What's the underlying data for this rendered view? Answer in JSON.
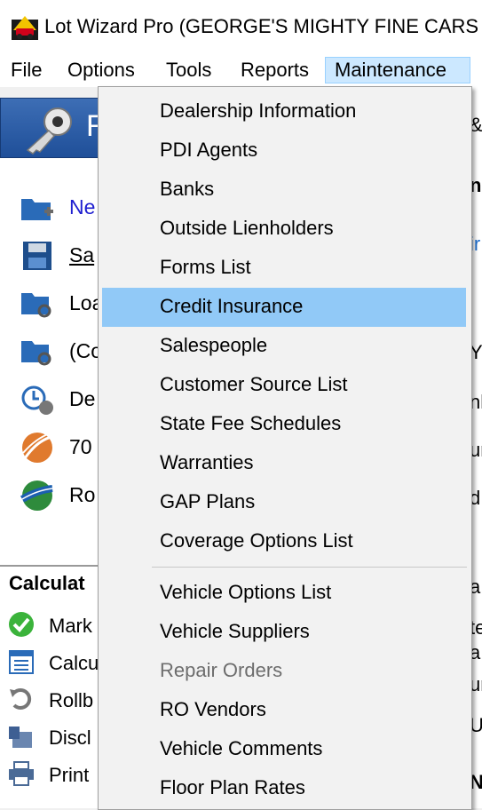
{
  "window": {
    "title": "Lot Wizard Pro (GEORGE'S  MIGHTY FINE CARS"
  },
  "menubar": {
    "items": [
      {
        "label": "File",
        "active": false
      },
      {
        "label": "Options",
        "active": false
      },
      {
        "label": "Tools",
        "active": false
      },
      {
        "label": "Reports",
        "active": false
      },
      {
        "label": "Maintenance",
        "active": true
      }
    ]
  },
  "background": {
    "panel_letter": "R",
    "left_items": [
      "Ne",
      "Sa",
      "Loa",
      "(Co",
      "De",
      "70",
      "Ro"
    ],
    "calc_header": "Calculat",
    "calc_items": [
      "Mark",
      "Calcu",
      "Rollb",
      "Discl",
      "Print"
    ],
    "right_fragments": [
      "&",
      "ni",
      "ir",
      "Y",
      "nl",
      "ur",
      "d",
      "a",
      "te",
      "a",
      "ur",
      "U",
      "N"
    ]
  },
  "maintenance_menu": {
    "group1": [
      {
        "label": "Dealership Information",
        "highlighted": false,
        "disabled": false
      },
      {
        "label": "PDI Agents",
        "highlighted": false,
        "disabled": false
      },
      {
        "label": "Banks",
        "highlighted": false,
        "disabled": false
      },
      {
        "label": "Outside Lienholders",
        "highlighted": false,
        "disabled": false
      },
      {
        "label": "Forms List",
        "highlighted": false,
        "disabled": false
      },
      {
        "label": "Credit Insurance",
        "highlighted": true,
        "disabled": false
      },
      {
        "label": "Salespeople",
        "highlighted": false,
        "disabled": false
      },
      {
        "label": "Customer Source List",
        "highlighted": false,
        "disabled": false
      },
      {
        "label": "State Fee Schedules",
        "highlighted": false,
        "disabled": false
      },
      {
        "label": "Warranties",
        "highlighted": false,
        "disabled": false
      },
      {
        "label": "GAP Plans",
        "highlighted": false,
        "disabled": false
      },
      {
        "label": "Coverage Options List",
        "highlighted": false,
        "disabled": false
      }
    ],
    "group2": [
      {
        "label": "Vehicle Options List",
        "highlighted": false,
        "disabled": false
      },
      {
        "label": "Vehicle Suppliers",
        "highlighted": false,
        "disabled": false
      },
      {
        "label": "Repair Orders",
        "highlighted": false,
        "disabled": true
      },
      {
        "label": "RO Vendors",
        "highlighted": false,
        "disabled": false
      },
      {
        "label": "Vehicle Comments",
        "highlighted": false,
        "disabled": false
      },
      {
        "label": "Floor Plan Rates",
        "highlighted": false,
        "disabled": false
      }
    ]
  },
  "colors": {
    "highlight": "#91c9f7",
    "menu_active": "#cce8ff",
    "panel_blue": "#2c5ea6"
  }
}
